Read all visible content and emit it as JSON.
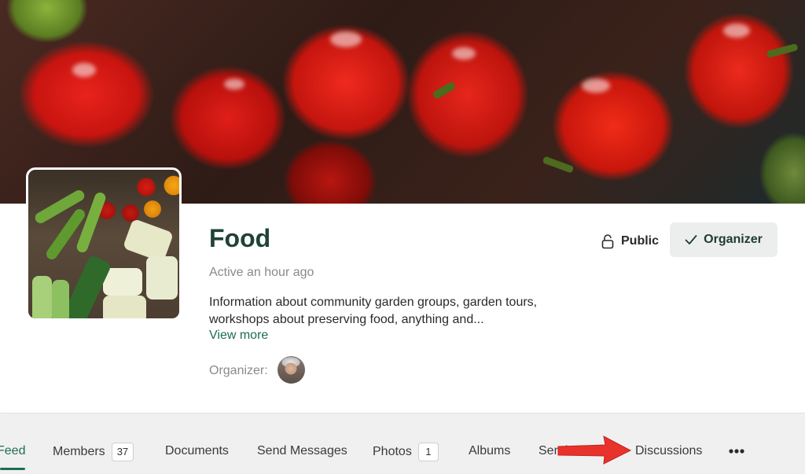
{
  "group": {
    "title": "Food",
    "activity": "Active an hour ago",
    "description_line1": "Information about community garden groups, garden tours,",
    "description_line2": "workshops about preserving food, anything and...",
    "view_more": "View more",
    "organizer_label": "Organizer:"
  },
  "actions": {
    "privacy_label": "Public",
    "role_label": "Organizer"
  },
  "tabs": [
    {
      "label": "Feed",
      "active": true
    },
    {
      "label": "Members",
      "count": "37"
    },
    {
      "label": "Documents"
    },
    {
      "label": "Send Messages"
    },
    {
      "label": "Photos",
      "count": "1"
    },
    {
      "label": "Albums"
    },
    {
      "label": "Send Invites"
    },
    {
      "label": "Discussions"
    }
  ],
  "icons": {
    "privacy": "lock-icon",
    "role": "check-icon",
    "more": "more-horizontal-icon"
  },
  "colors": {
    "accent": "#1d6e4e",
    "title": "#1f4238",
    "annotation_arrow": "#e8322c"
  }
}
